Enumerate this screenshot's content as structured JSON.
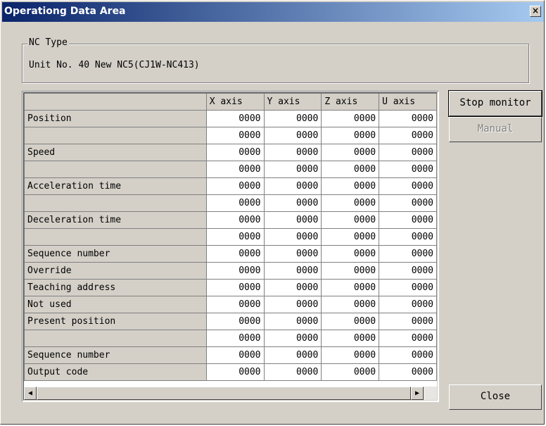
{
  "window": {
    "title": "Operationg Data Area",
    "close_glyph": "×"
  },
  "nc_type": {
    "label": "NC Type",
    "value": "Unit No. 40 New NC5(CJ1W-NC413)"
  },
  "grid": {
    "columns": [
      "",
      "X axis",
      "Y axis",
      "Z axis",
      "U axis"
    ],
    "rows": [
      {
        "label": "Position",
        "values": [
          "0000",
          "0000",
          "0000",
          "0000"
        ]
      },
      {
        "label": "",
        "values": [
          "0000",
          "0000",
          "0000",
          "0000"
        ]
      },
      {
        "label": "Speed",
        "values": [
          "0000",
          "0000",
          "0000",
          "0000"
        ]
      },
      {
        "label": "",
        "values": [
          "0000",
          "0000",
          "0000",
          "0000"
        ]
      },
      {
        "label": "Acceleration time",
        "values": [
          "0000",
          "0000",
          "0000",
          "0000"
        ]
      },
      {
        "label": "",
        "values": [
          "0000",
          "0000",
          "0000",
          "0000"
        ]
      },
      {
        "label": "Deceleration time",
        "values": [
          "0000",
          "0000",
          "0000",
          "0000"
        ]
      },
      {
        "label": "",
        "values": [
          "0000",
          "0000",
          "0000",
          "0000"
        ]
      },
      {
        "label": "Sequence number",
        "values": [
          "0000",
          "0000",
          "0000",
          "0000"
        ]
      },
      {
        "label": "Override",
        "values": [
          "0000",
          "0000",
          "0000",
          "0000"
        ]
      },
      {
        "label": "Teaching address",
        "values": [
          "0000",
          "0000",
          "0000",
          "0000"
        ]
      },
      {
        "label": "Not used",
        "values": [
          "0000",
          "0000",
          "0000",
          "0000"
        ]
      },
      {
        "label": "Present position",
        "values": [
          "0000",
          "0000",
          "0000",
          "0000"
        ]
      },
      {
        "label": "",
        "values": [
          "0000",
          "0000",
          "0000",
          "0000"
        ]
      },
      {
        "label": "Sequence number",
        "values": [
          "0000",
          "0000",
          "0000",
          "0000"
        ]
      },
      {
        "label": "Output code",
        "values": [
          "0000",
          "0000",
          "0000",
          "0000"
        ]
      }
    ]
  },
  "scrollbar": {
    "left_arrow": "◀",
    "right_arrow": "▶"
  },
  "buttons": {
    "stop_monitor": "Stop monitor",
    "manual": "Manual",
    "close": "Close"
  },
  "icons": {
    "close": "close-icon",
    "scroll_left": "arrow-left-icon",
    "scroll_right": "arrow-right-icon"
  }
}
